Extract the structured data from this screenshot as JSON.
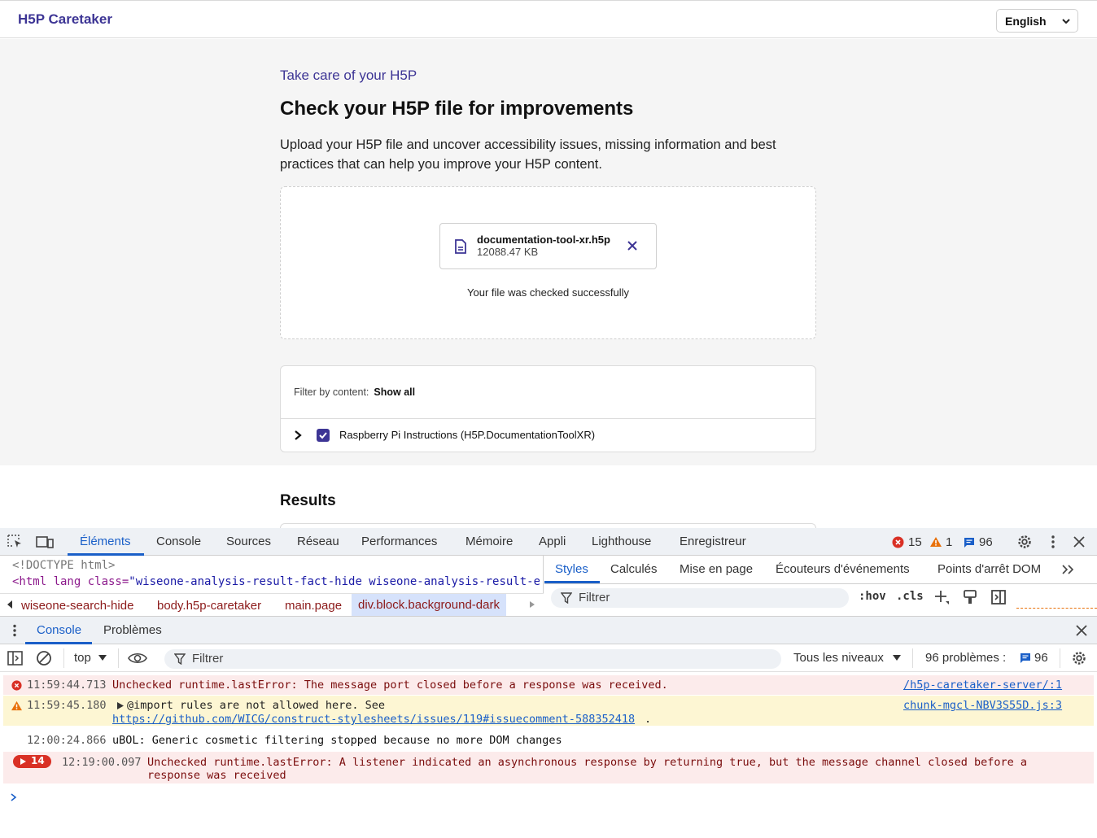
{
  "header": {
    "brand": "H5P Caretaker",
    "language": "English"
  },
  "main": {
    "kicker": "Take care of your H5P",
    "title": "Check your H5P file for improvements",
    "lead": "Upload your H5P file and uncover accessibility issues, missing information and best practices that can help you improve your H5P content.",
    "file": {
      "name": "documentation-tool-xr.h5p",
      "size": "12088.47 KB"
    },
    "status": "Your file was checked successfully",
    "filter": {
      "label": "Filter by content:",
      "value": "Show all",
      "item": "Raspberry Pi Instructions (H5P.DocumentationToolXR)"
    },
    "results_heading": "Results"
  },
  "devtools": {
    "tabs": [
      "Éléments",
      "Console",
      "Sources",
      "Réseau",
      "Performances",
      "Mémoire",
      "Appli",
      "Lighthouse",
      "Enregistreur"
    ],
    "errors": "15",
    "warnings": "1",
    "issues": "96",
    "doctype": "<!DOCTYPE html>",
    "html_line_tag": "<html lang class=",
    "html_line_attr": "\"wiseone-analysis-result-fact-hide wiseone-analysis-result-en",
    "breadcrumbs": [
      "wiseone-search-hide",
      "body.h5p-caretaker",
      "main.page",
      "div.block.background-dark"
    ],
    "styles_tabs": [
      "Styles",
      "Calculés",
      "Mise en page",
      "Écouteurs d'événements",
      "Points d'arrêt DOM"
    ],
    "styles_filter": "Filtrer",
    "hov": ":hov",
    "cls": ".cls",
    "drawer_tabs": [
      "Console",
      "Problèmes"
    ],
    "context": "top",
    "console_filter": "Filtrer",
    "levels": "Tous les niveaux",
    "problems_label": "96 problèmes :",
    "problems_count": "96",
    "messages": [
      {
        "time": "11:59:44.713",
        "text": "Unchecked runtime.lastError: The message port closed before a response was received.",
        "source": "/h5p-caretaker-server/:1"
      },
      {
        "time": "11:59:45.180",
        "text": "@import rules are not allowed here. See",
        "link": "https://github.com/WICG/construct-stylesheets/issues/119#issuecomment-588352418",
        "source": "chunk-mgcl-NBV3S55D.js:3"
      },
      {
        "time": "12:00:24.866",
        "text": "uBOL: Generic cosmetic filtering stopped because no more DOM changes"
      },
      {
        "badge": "14",
        "time": "12:19:00.097",
        "text": "Unchecked runtime.lastError: A listener indicated an asynchronous response by returning true, but the message channel closed before a",
        "text2": "response was received"
      }
    ],
    "colors": {
      "accent": "#3d3595",
      "devtools_blue": "#1a5fc8",
      "error": "#d93025",
      "warning": "#e8710a"
    }
  }
}
